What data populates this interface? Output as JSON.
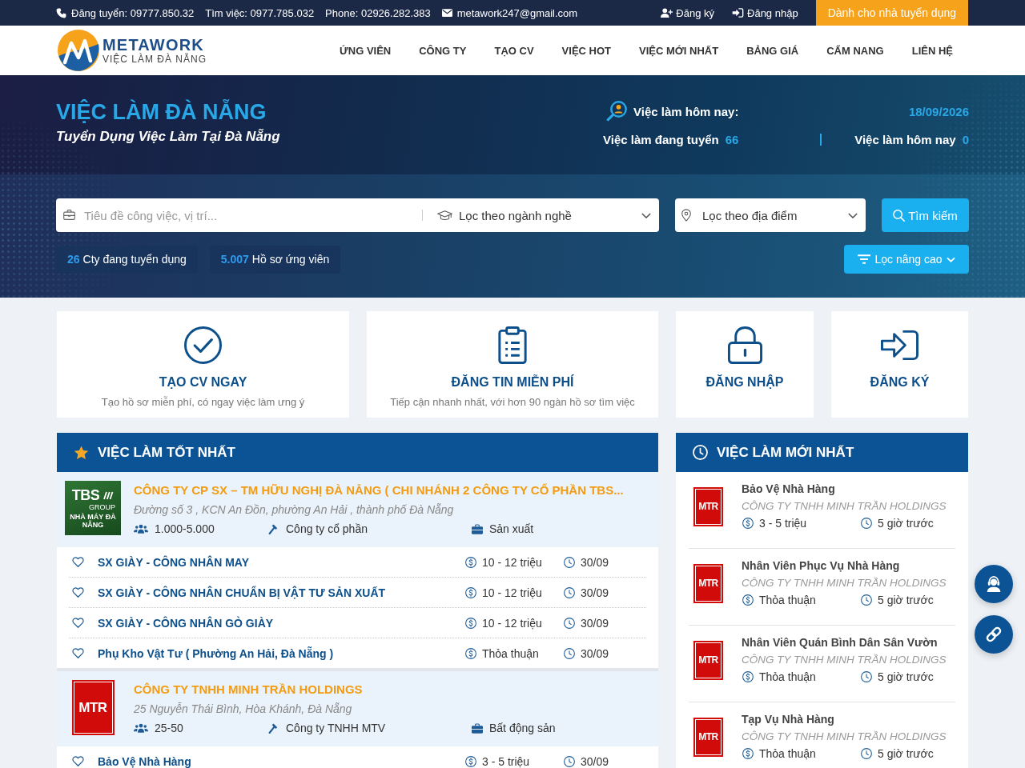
{
  "top_bar": {
    "contacts": [
      {
        "kind": "phone",
        "text": "Đăng tuyển: 09777.850.32"
      },
      {
        "kind": "plain",
        "text": "Tìm việc: 0977.785.032"
      },
      {
        "kind": "plain",
        "text": "Phone: 02926.282.383"
      },
      {
        "kind": "email",
        "text": "metawork247@gmail.com"
      }
    ],
    "account_links": [
      {
        "kind": "register",
        "label": "Đăng ký"
      },
      {
        "kind": "login",
        "label": "Đăng nhập"
      }
    ],
    "employer_button": "Dành cho nhà tuyển dụng"
  },
  "header": {
    "logo": {
      "name": "METAWORK",
      "tagline": "VIỆC LÀM ĐÀ NẴNG"
    },
    "nav": [
      "ỨNG VIÊN",
      "CÔNG TY",
      "TẠO CV",
      "VIỆC HOT",
      "VIỆC MỚI NHẤT",
      "BẢNG GIÁ",
      "CẨM NANG",
      "LIÊN HỆ"
    ]
  },
  "hero": {
    "title": "VIỆC LÀM ĐÀ NẴNG",
    "subtitle": "Tuyển Dụng Việc Làm Tại Đà Nẵng",
    "today_heading": "Việc làm hôm nay:",
    "date": "18/09/2026",
    "stats": [
      {
        "label": "Việc làm đang tuyển",
        "value": "66"
      },
      {
        "label": "Việc làm hôm nay",
        "value": "0"
      }
    ]
  },
  "search": {
    "keyword": {
      "placeholder": "Tiêu đề công việc, vị trí..."
    },
    "industry": {
      "value": "Lọc theo ngành nghề"
    },
    "location": {
      "value": "Lọc theo địa điểm"
    },
    "button": "Tìm kiếm",
    "counters": [
      {
        "value": "26",
        "label": "Cty đang tuyển dụng"
      },
      {
        "value": "5.007",
        "label": "Hồ sơ ứng viên"
      }
    ],
    "advanced_filter": "Lọc nâng cao"
  },
  "features": [
    {
      "kind": "create_cv",
      "title": "TẠO CV NGAY",
      "description": "Tạo hồ sơ miễn phí, có ngay việc làm ưng ý"
    },
    {
      "kind": "post_job",
      "title": "ĐĂNG TIN MIỄN PHÍ",
      "description": "Tiếp cận nhanh nhất, với hơn 90 ngàn hồ sơ tìm việc"
    },
    {
      "kind": "login",
      "title": "ĐĂNG NHẬP"
    },
    {
      "kind": "register",
      "title": "ĐĂNG KÝ"
    }
  ],
  "best_jobs": {
    "title": "VIỆC LÀM TỐT NHẤT",
    "companies": [
      {
        "logo": {
          "kind": "green",
          "text": "TBS",
          "sub": "GROUP",
          "caption": "NHÀ MÁY ĐÀ NẴNG"
        },
        "name": "CÔNG TY CP SX – TM HỮU NGHỊ ĐÀ NẴNG ( CHI NHÁNH 2 CÔNG TY CỔ PHẦN TBS...",
        "address": "Đường số 3 , KCN An Đồn, phường An Hải , thành phố Đà Nẵng",
        "size": "1.000-5.000",
        "type": "Công ty cổ phần",
        "industry": "Sản xuất",
        "jobs": [
          {
            "title": "SX GIÀY - CÔNG NHÂN MAY",
            "salary": "10 - 12 triệu",
            "deadline": "30/09"
          },
          {
            "title": "SX GIÀY - CÔNG NHÂN CHUẨN BỊ VẬT TƯ SẢN XUẤT",
            "salary": "10 - 12 triệu",
            "deadline": "30/09"
          },
          {
            "title": "SX GIÀY - CÔNG NHÂN GÒ GIÀY",
            "salary": "10 - 12 triệu",
            "deadline": "30/09"
          },
          {
            "title": "Phụ Kho Vật Tư ( Phường An Hải, Đà Nẵng )",
            "salary": "Thỏa thuận",
            "deadline": "30/09"
          }
        ]
      },
      {
        "logo": {
          "kind": "red",
          "text": "MTR"
        },
        "name": "CÔNG TY TNHH MINH TRẦN HOLDINGS",
        "address": "25 Nguyễn Thái Bình, Hòa Khánh, Đà Nẵng",
        "size": "25-50",
        "type": "Công ty TNHH MTV",
        "industry": "Bất động sản",
        "jobs": [
          {
            "title": "Bảo Vệ Nhà Hàng",
            "salary": "3 - 5 triệu",
            "deadline": "30/09"
          }
        ]
      }
    ]
  },
  "latest_jobs": {
    "title": "VIỆC LÀM MỚI NHẤT",
    "items": [
      {
        "logo": "MTR",
        "title": "Bảo Vệ Nhà Hàng",
        "company": "CÔNG TY TNHH MINH TRẦN HOLDINGS",
        "salary": "3 - 5 triệu",
        "posted": "5 giờ trước"
      },
      {
        "logo": "MTR",
        "title": "Nhân Viên Phục Vụ Nhà Hàng",
        "company": "CÔNG TY TNHH MINH TRẦN HOLDINGS",
        "salary": "Thỏa thuận",
        "posted": "5 giờ trước"
      },
      {
        "logo": "MTR",
        "title": "Nhân Viên Quán Bình Dân Sân Vườn",
        "company": "CÔNG TY TNHH MINH TRẦN HOLDINGS",
        "salary": "Thỏa thuận",
        "posted": "5 giờ trước"
      },
      {
        "logo": "MTR",
        "title": "Tạp Vụ Nhà Hàng",
        "company": "CÔNG TY TNHH MINH TRẦN HOLDINGS",
        "salary": "Thỏa thuận",
        "posted": "5 giờ trước"
      }
    ]
  }
}
